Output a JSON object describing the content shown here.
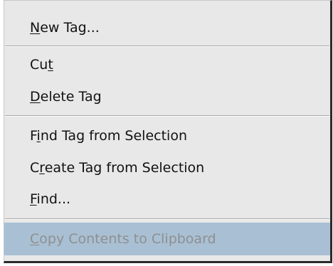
{
  "menu": {
    "items": [
      {
        "pre": "",
        "key": "N",
        "post": "ew Tag...",
        "disabled": false,
        "selected": false
      },
      {
        "pre": "Cu",
        "key": "t",
        "post": "",
        "disabled": false,
        "selected": false
      },
      {
        "pre": "",
        "key": "D",
        "post": "elete Tag",
        "disabled": false,
        "selected": false
      },
      {
        "pre": "F",
        "key": "i",
        "post": "nd Tag from Selection",
        "disabled": false,
        "selected": false
      },
      {
        "pre": "C",
        "key": "r",
        "post": "eate Tag from Selection",
        "disabled": false,
        "selected": false
      },
      {
        "pre": "",
        "key": "F",
        "post": "ind...",
        "disabled": false,
        "selected": false
      },
      {
        "pre": "",
        "key": "C",
        "post": "opy Contents to Clipboard",
        "disabled": true,
        "selected": true
      }
    ]
  },
  "colors": {
    "menu_background": "#e8e8e8",
    "highlight": "#a9c0d4",
    "disabled_text": "#8f8f8f"
  }
}
